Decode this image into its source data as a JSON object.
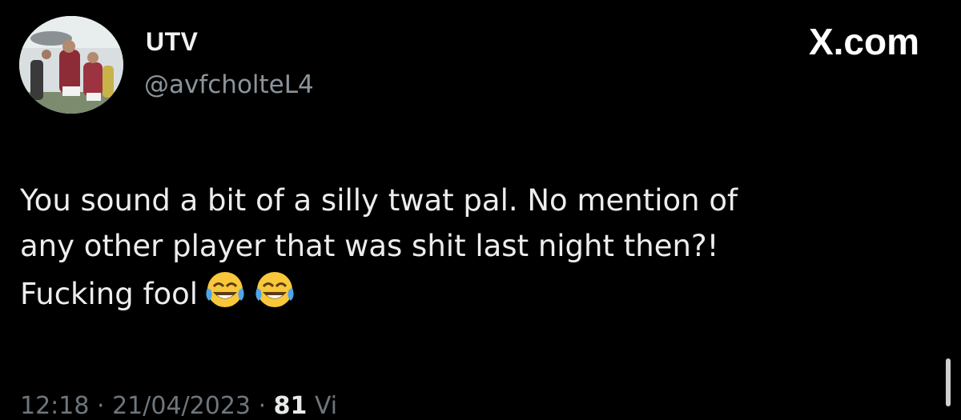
{
  "tweet": {
    "author": {
      "display_name": "UTV",
      "handle": "@avfcholteL4",
      "avatar_icon": "avatar-photo-icon"
    },
    "brand": {
      "logo_icon": "x-logo-icon",
      "text": "X.com"
    },
    "text_lines": [
      "You sound a bit of a silly twat pal. No mention of",
      "any other player that was shit last night then?!",
      "Fucking fool"
    ],
    "emojis": [
      "face-with-tears-of-joy-icon",
      "face-with-tears-of-joy-icon"
    ],
    "meta": {
      "time": "12:18",
      "date": "21/04/2023",
      "views_count": "81",
      "views_label": "Vi"
    }
  },
  "colors": {
    "background": "#000000",
    "primary_text": "#e7e9ea",
    "secondary_text": "#8b949b"
  }
}
